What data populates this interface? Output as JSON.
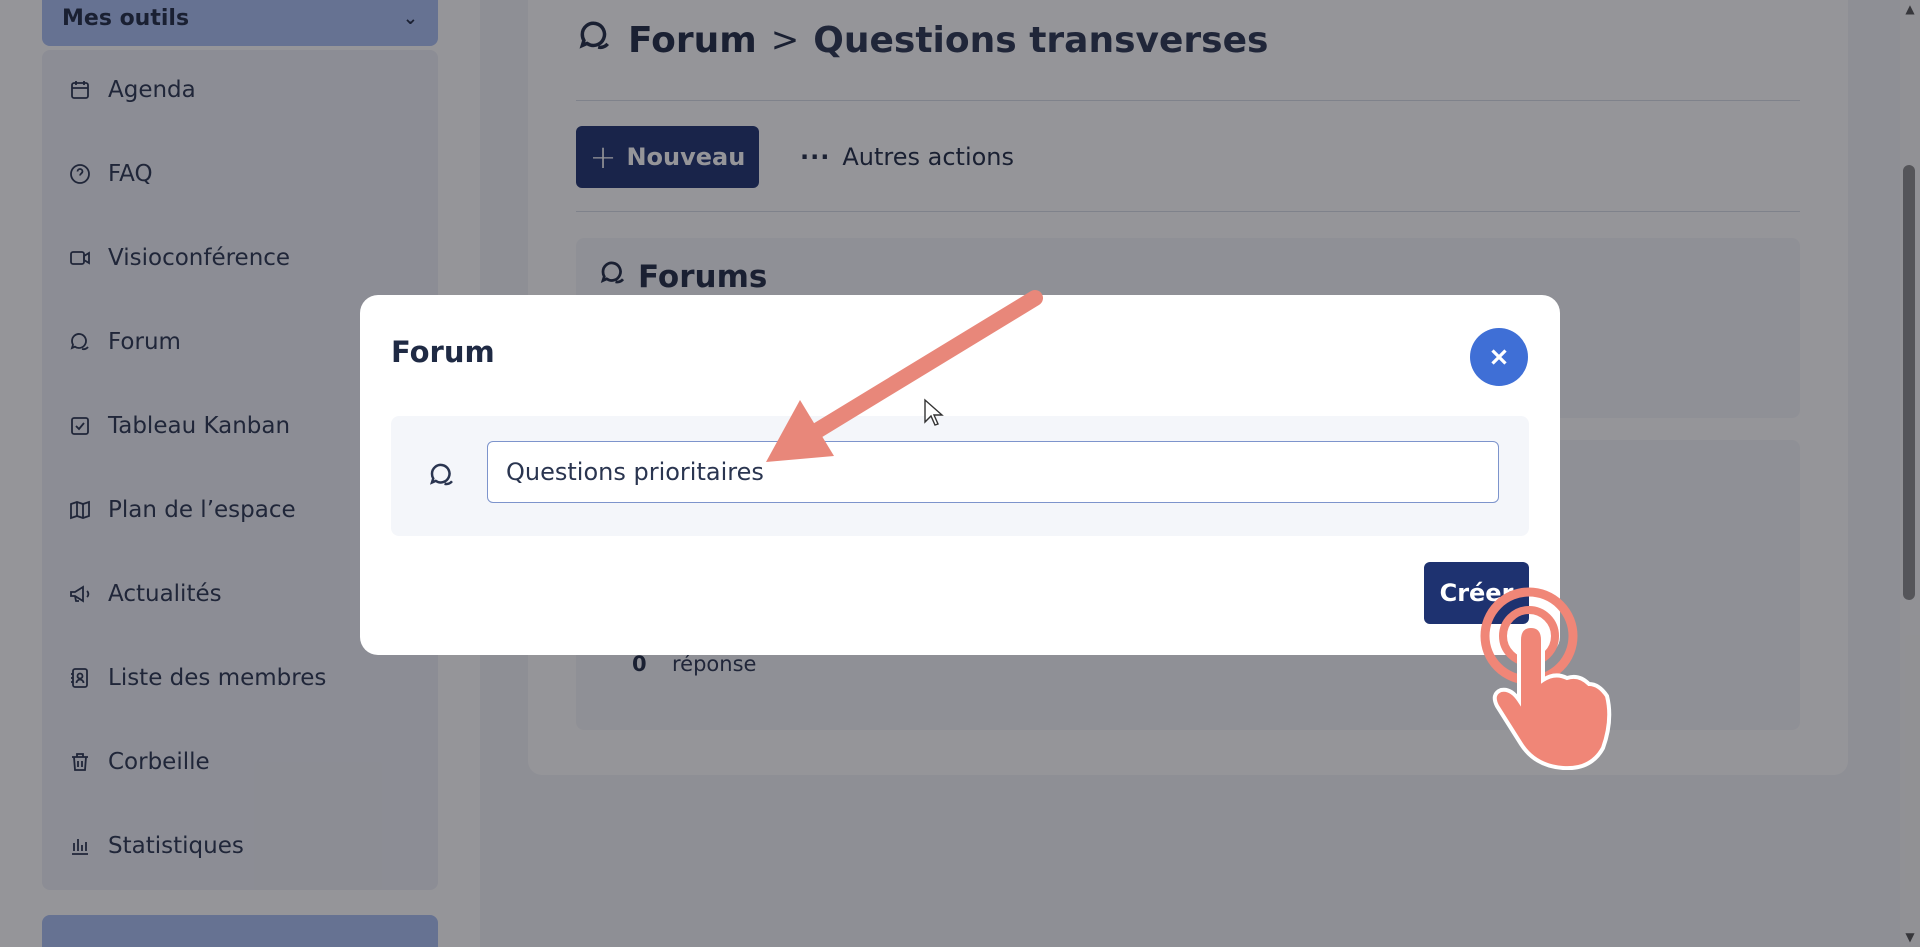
{
  "sidebar": {
    "group_label": "Mes outils",
    "items": [
      {
        "label": "Agenda",
        "icon": "calendar-icon"
      },
      {
        "label": "FAQ",
        "icon": "help-circle-icon"
      },
      {
        "label": "Visioconférence",
        "icon": "video-icon"
      },
      {
        "label": "Forum",
        "icon": "chat-bubbles-icon"
      },
      {
        "label": "Tableau Kanban",
        "icon": "checkbox-icon"
      },
      {
        "label": "Plan de l’espace",
        "icon": "map-icon"
      },
      {
        "label": "Actualités",
        "icon": "megaphone-icon"
      },
      {
        "label": "Liste des membres",
        "icon": "contact-book-icon"
      },
      {
        "label": "Corbeille",
        "icon": "trash-icon"
      },
      {
        "label": "Statistiques",
        "icon": "bar-chart-icon"
      }
    ]
  },
  "breadcrumb": {
    "root": "Forum",
    "separator": ">",
    "current": "Questions transverses"
  },
  "toolbar": {
    "new_label": "Nouveau",
    "more_label": "Autres actions"
  },
  "forums": {
    "title": "Forums"
  },
  "list": {
    "reply_count": "0",
    "reply_label": "réponse"
  },
  "modal": {
    "title": "Forum",
    "input_value": "Questions prioritaires",
    "create_label": "Créer"
  },
  "colors": {
    "primary": "#1e3270",
    "close_button": "#3f6fd6",
    "annotation": "#e8877a",
    "sidebar_accent": "#a9bff3"
  }
}
